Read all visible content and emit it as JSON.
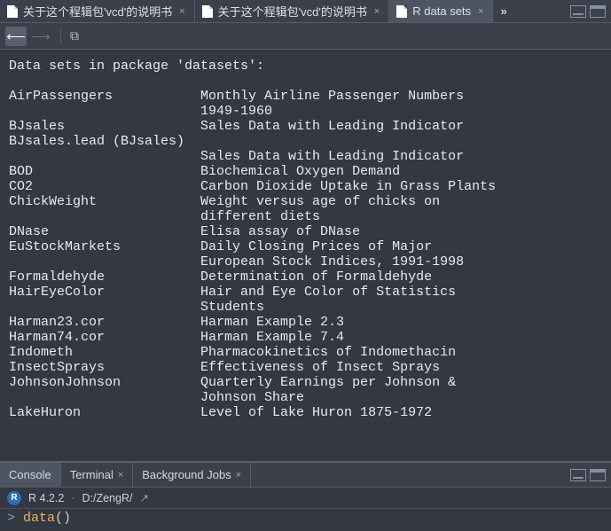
{
  "tabs": [
    {
      "label": "关于这个程辑包'vcd'的说明书",
      "active": false,
      "closeable": true
    },
    {
      "label": "关于这个程辑包'vcd'的说明书",
      "active": false,
      "closeable": true
    },
    {
      "label": "R data sets",
      "active": true,
      "closeable": true
    }
  ],
  "viewer": {
    "heading": "Data sets in package 'datasets':",
    "items": [
      {
        "name": "AirPassengers",
        "desc": "Monthly Airline Passenger Numbers\n1949-1960"
      },
      {
        "name": "BJsales",
        "desc": "Sales Data with Leading Indicator"
      },
      {
        "name": "BJsales.lead (BJsales)",
        "desc": "Sales Data with Leading Indicator",
        "wrap_name": true
      },
      {
        "name": "BOD",
        "desc": "Biochemical Oxygen Demand"
      },
      {
        "name": "CO2",
        "desc": "Carbon Dioxide Uptake in Grass Plants"
      },
      {
        "name": "ChickWeight",
        "desc": "Weight versus age of chicks on\ndifferent diets"
      },
      {
        "name": "DNase",
        "desc": "Elisa assay of DNase"
      },
      {
        "name": "EuStockMarkets",
        "desc": "Daily Closing Prices of Major\nEuropean Stock Indices, 1991-1998"
      },
      {
        "name": "Formaldehyde",
        "desc": "Determination of Formaldehyde"
      },
      {
        "name": "HairEyeColor",
        "desc": "Hair and Eye Color of Statistics\nStudents"
      },
      {
        "name": "Harman23.cor",
        "desc": "Harman Example 2.3"
      },
      {
        "name": "Harman74.cor",
        "desc": "Harman Example 7.4"
      },
      {
        "name": "Indometh",
        "desc": "Pharmacokinetics of Indomethacin"
      },
      {
        "name": "InsectSprays",
        "desc": "Effectiveness of Insect Sprays"
      },
      {
        "name": "JohnsonJohnson",
        "desc": "Quarterly Earnings per Johnson &\nJohnson Share"
      },
      {
        "name": "LakeHuron",
        "desc": "Level of Lake Huron 1875-1972"
      }
    ]
  },
  "bottom_tabs": [
    {
      "label": "Console",
      "active": true,
      "closeable": false
    },
    {
      "label": "Terminal",
      "active": false,
      "closeable": true
    },
    {
      "label": "Background Jobs",
      "active": false,
      "closeable": true
    }
  ],
  "console": {
    "r_badge": "R",
    "version": "R 4.2.2",
    "sep": "·",
    "cwd": "D:/ZengR/",
    "prompt": ">",
    "input_call": "data",
    "input_parens": "()"
  }
}
